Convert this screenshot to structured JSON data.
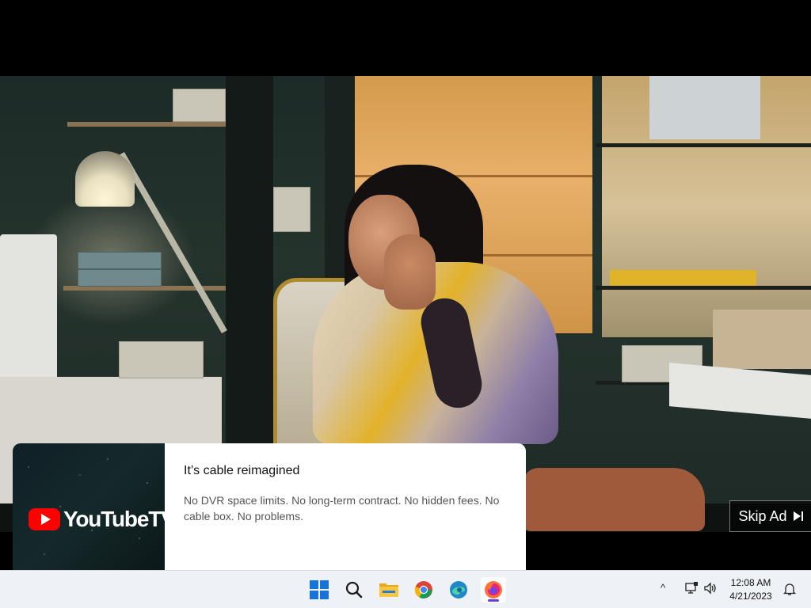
{
  "ad": {
    "brand": "YouTubeTV",
    "title": "It’s cable reimagined",
    "description": "No DVR space limits. No long-term contract. No hidden fees. No cable box. No problems."
  },
  "player": {
    "skip_label": "Skip Ad"
  },
  "taskbar": {
    "items": [
      {
        "name": "start-button",
        "icon": "windows-icon"
      },
      {
        "name": "search-button",
        "icon": "search-icon"
      },
      {
        "name": "file-explorer",
        "icon": "folder-icon"
      },
      {
        "name": "chrome",
        "icon": "chrome-icon"
      },
      {
        "name": "edge",
        "icon": "edge-icon"
      },
      {
        "name": "firefox",
        "icon": "firefox-icon",
        "active": true
      }
    ],
    "tray_chevron": "^",
    "clock": {
      "time": "12:08 AM",
      "date": "4/21/2023"
    }
  },
  "colors": {
    "youtube_red": "#ff0000",
    "taskbar_bg": "#eef1f5",
    "active_indicator": "#6b3fd1"
  }
}
